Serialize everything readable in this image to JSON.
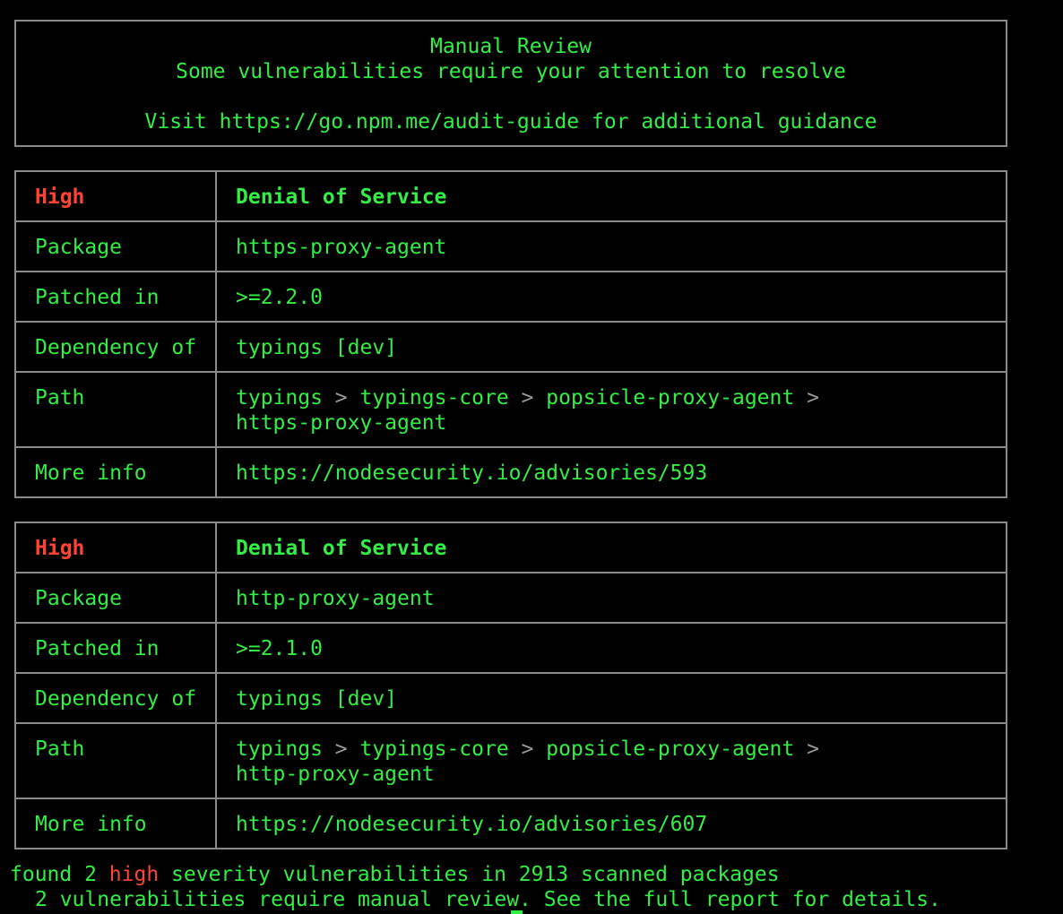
{
  "colors": {
    "background": "#000000",
    "text": "#33ee44",
    "severity_high": "#ff4433",
    "border": "#8a8a8a",
    "path_separator": "#9a9a9a"
  },
  "header": {
    "title": "Manual Review",
    "subtitle": "Some vulnerabilities require your attention to resolve",
    "guide": "Visit https://go.npm.me/audit-guide for additional guidance"
  },
  "labels": {
    "package": "Package",
    "patched_in": "Patched in",
    "dependency_of": "Dependency of",
    "path": "Path",
    "more_info": "More info"
  },
  "path_separator": ">",
  "advisories": [
    {
      "severity": "High",
      "title": "Denial of Service",
      "package": "https-proxy-agent",
      "patched_in": ">=2.2.0",
      "dependency_of": "typings [dev]",
      "path": [
        "typings",
        "typings-core",
        "popsicle-proxy-agent",
        "https-proxy-agent"
      ],
      "more_info": "https://nodesecurity.io/advisories/593"
    },
    {
      "severity": "High",
      "title": "Denial of Service",
      "package": "http-proxy-agent",
      "patched_in": ">=2.1.0",
      "dependency_of": "typings [dev]",
      "path": [
        "typings",
        "typings-core",
        "popsicle-proxy-agent",
        "http-proxy-agent"
      ],
      "more_info": "https://nodesecurity.io/advisories/607"
    }
  ],
  "summary": {
    "found_prefix": "found 2",
    "severity_word": "high",
    "found_suffix": "severity vulnerabilities in 2913 scanned packages",
    "manual": "2 vulnerabilities require manual review. See the full report for details."
  }
}
